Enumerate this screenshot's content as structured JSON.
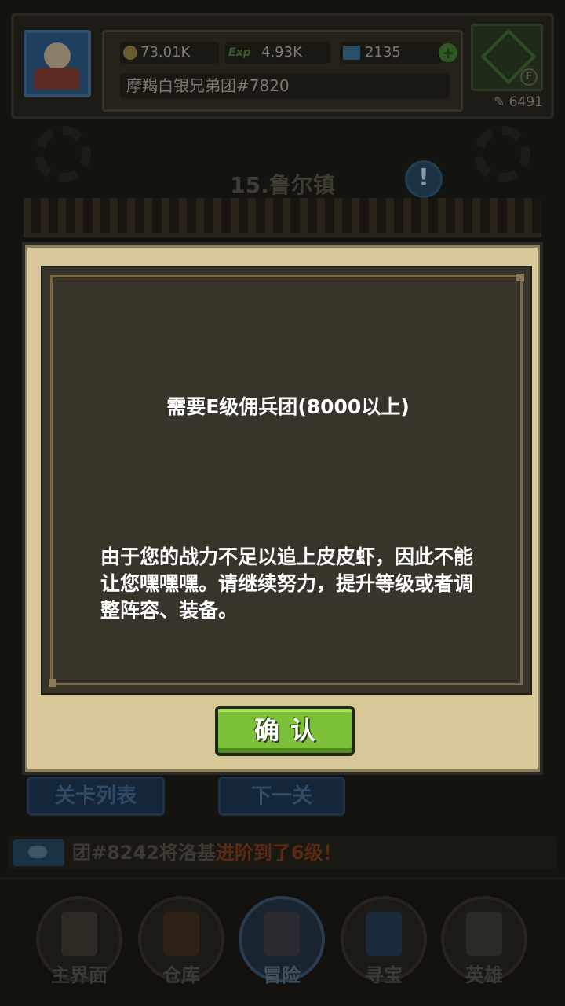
{
  "header": {
    "gold": "73.01K",
    "exp_label": "Exp",
    "exp": "4.93K",
    "gems": "2135",
    "guild_name": "摩羯白银兄弟团#7820",
    "combat_power": "6491",
    "rank_letter": "F"
  },
  "stage": {
    "title": "15.鲁尔镇",
    "alert": "!"
  },
  "dialog": {
    "requirement": "需要E级佣兵团(8000以上)",
    "message": "由于您的战力不足以追上皮皮虾，因此不能让您嘿嘿嘿。请继续努力，提升等级或者调整阵容、装备。",
    "confirm_label": "确认"
  },
  "bottom_buttons": {
    "stage_list": "关卡列表",
    "next": "下一关"
  },
  "ticker": {
    "prefix": "团#8242将洛基",
    "highlight": "进阶到了6级！"
  },
  "nav": [
    {
      "label": "主界面"
    },
    {
      "label": "仓库"
    },
    {
      "label": "冒险"
    },
    {
      "label": "寻宝"
    },
    {
      "label": "英雄"
    }
  ],
  "colors": {
    "dialog_bg": "#d8c898",
    "dialog_panel": "#38342a",
    "confirm_green": "#7cc03a"
  }
}
